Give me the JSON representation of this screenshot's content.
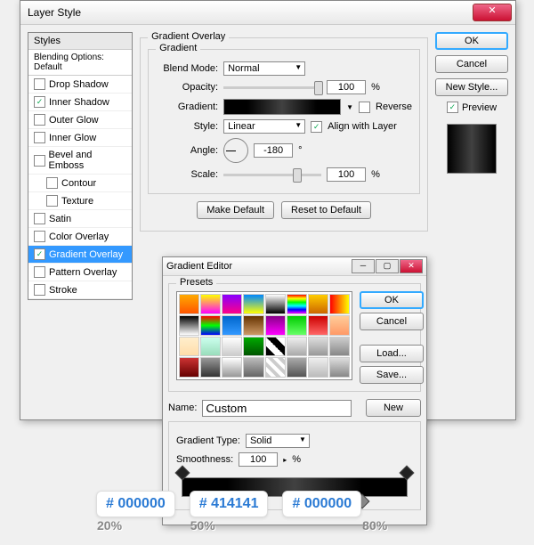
{
  "dialog": {
    "title": "Layer Style",
    "stylesHeader": "Styles",
    "blendingOptions": "Blending Options: Default",
    "items": {
      "dropShadow": "Drop Shadow",
      "innerShadow": "Inner Shadow",
      "outerGlow": "Outer Glow",
      "innerGlow": "Inner Glow",
      "bevel": "Bevel and Emboss",
      "contour": "Contour",
      "texture": "Texture",
      "satin": "Satin",
      "colorOverlay": "Color Overlay",
      "gradientOverlay": "Gradient Overlay",
      "patternOverlay": "Pattern Overlay",
      "stroke": "Stroke"
    },
    "panel": {
      "title": "Gradient Overlay",
      "subtitle": "Gradient",
      "blendMode": "Blend Mode:",
      "blendModeVal": "Normal",
      "opacity": "Opacity:",
      "opacityVal": "100",
      "pct": "%",
      "gradient": "Gradient:",
      "reverse": "Reverse",
      "style": "Style:",
      "styleVal": "Linear",
      "alignLayer": "Align with Layer",
      "angle": "Angle:",
      "angleVal": "-180",
      "deg": "°",
      "scale": "Scale:",
      "scaleVal": "100",
      "makeDefault": "Make Default",
      "resetDefault": "Reset to Default"
    },
    "buttons": {
      "ok": "OK",
      "cancel": "Cancel",
      "newStyle": "New Style...",
      "preview": "Preview"
    }
  },
  "editor": {
    "title": "Gradient Editor",
    "presets": "Presets",
    "ok": "OK",
    "cancel": "Cancel",
    "load": "Load...",
    "save": "Save...",
    "name": "Name:",
    "nameVal": "Custom",
    "new": "New",
    "gradType": "Gradient Type:",
    "gradTypeVal": "Solid",
    "smoothness": "Smoothness:",
    "smoothVal": "100",
    "pct": "%"
  },
  "callouts": {
    "c1": "# 000000",
    "p1": "20%",
    "c2": "# 414141",
    "p2": "50%",
    "c3": "# 000000",
    "p3": "80%"
  },
  "swatches": [
    "linear-gradient(#fa0,#f50)",
    "linear-gradient(#ff0,#f0f)",
    "linear-gradient(#80f,#f08)",
    "linear-gradient(#08f,#ff0)",
    "linear-gradient(#fff,#000)",
    "linear-gradient(#f00,#ff0,#0f0,#0ff,#00f,#f0f)",
    "linear-gradient(#fc0,#c60)",
    "linear-gradient(90deg,#f00,#ff0)",
    "linear-gradient(#000,#fff)",
    "linear-gradient(#f00,#0f0,#00f)",
    "linear-gradient(#06c,#39f)",
    "linear-gradient(#630,#c96)",
    "linear-gradient(#808,#f0f)",
    "linear-gradient(#0c0,#6f6)",
    "linear-gradient(#c00,#f66)",
    "linear-gradient(#fc9,#f96)",
    "linear-gradient(#fec,#fda)",
    "linear-gradient(#cfe,#9db)",
    "linear-gradient(#fff,#ccc)",
    "linear-gradient(#0a0,#050)",
    "linear-gradient(45deg,#000 25%,#fff 25%,#fff 50%,#000 50%,#000 75%,#fff 75%)",
    "linear-gradient(#eee,#aaa)",
    "linear-gradient(#ddd,#999)",
    "linear-gradient(#ccc,#888)",
    "linear-gradient(#c33,#600)",
    "linear-gradient(#999,#333)",
    "linear-gradient(#fff,#999)",
    "linear-gradient(#bbb,#666)",
    "repeating-linear-gradient(45deg,#ccc 0 4px,#fff 4px 8px)",
    "linear-gradient(#aaa,#555)",
    "linear-gradient(#eee,#bbb)",
    "linear-gradient(#ddd,#888)"
  ]
}
